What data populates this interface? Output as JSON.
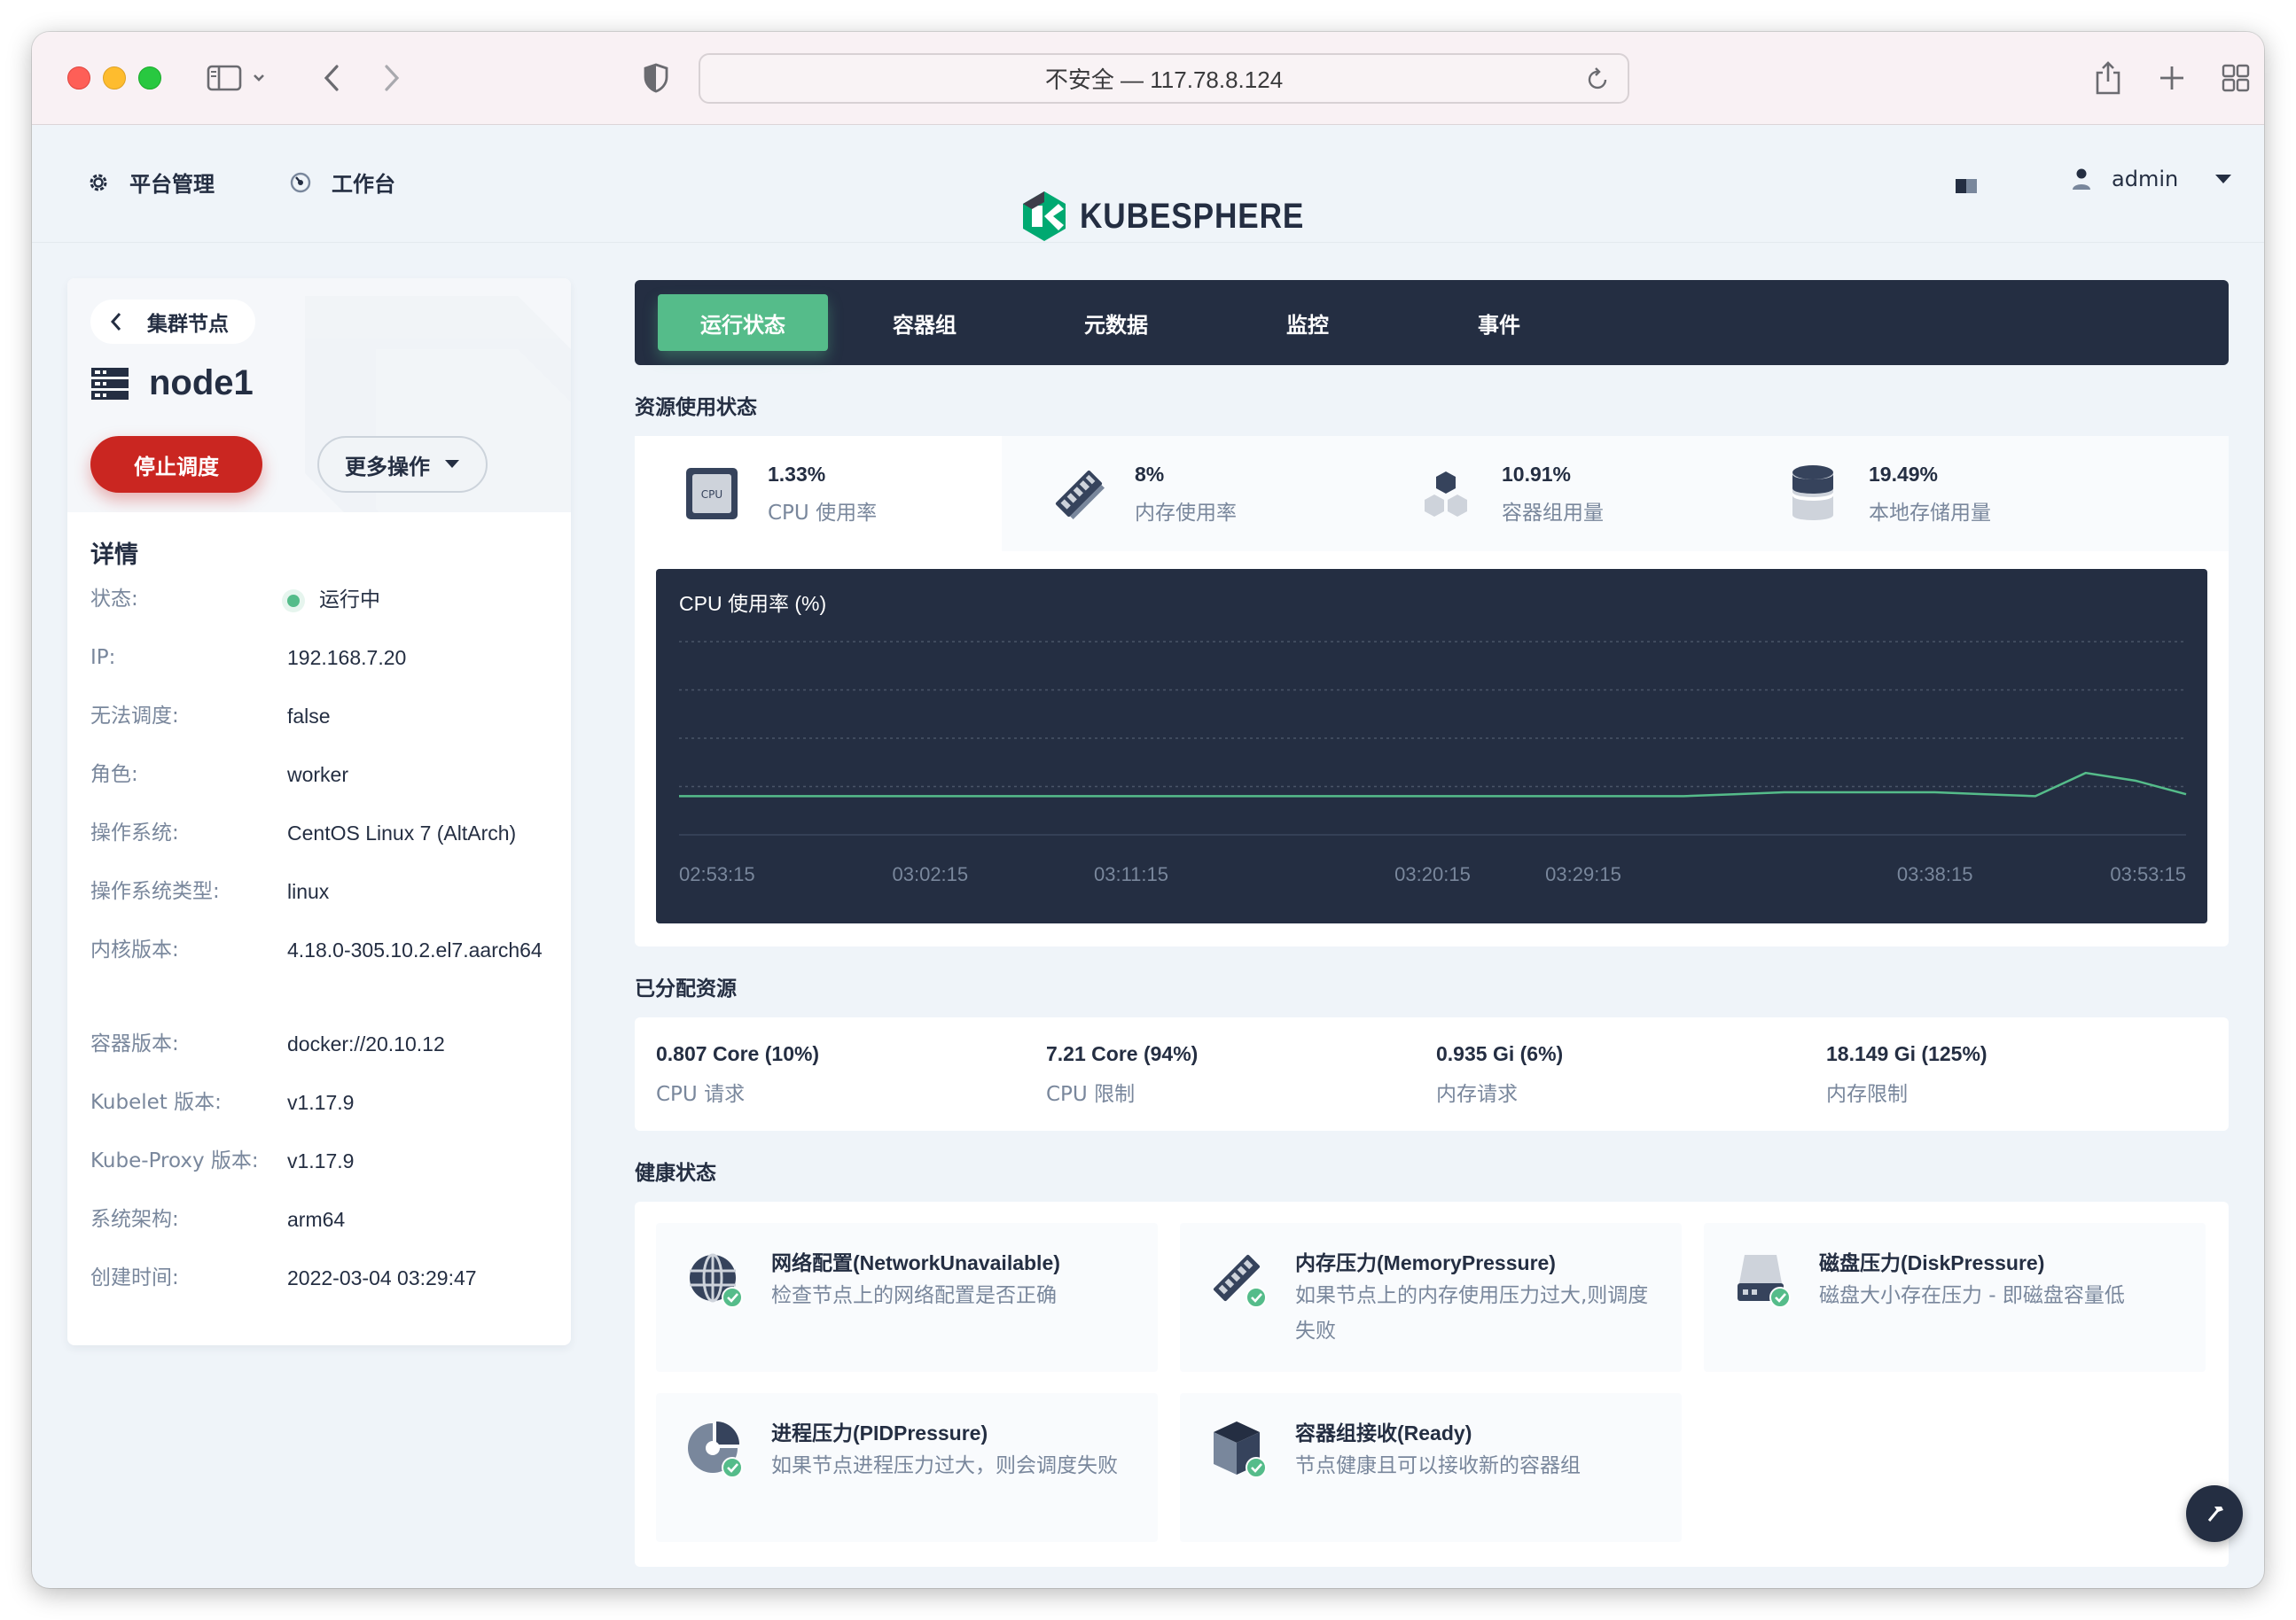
{
  "browser": {
    "address": "不安全 — 117.78.8.124"
  },
  "topnav": {
    "platform_label": "平台管理",
    "workbench_label": "工作台",
    "logo_text": "KUBESPHERE",
    "user_name": "admin"
  },
  "node": {
    "back_label": "集群节点",
    "name": "node1",
    "stop_button": "停止调度",
    "more_button": "更多操作",
    "details_title": "详情",
    "details": [
      {
        "key": "状态:",
        "value": "运行中"
      },
      {
        "key": "IP:",
        "value": "192.168.7.20"
      },
      {
        "key": "无法调度:",
        "value": "false"
      },
      {
        "key": "角色:",
        "value": "worker"
      },
      {
        "key": "操作系统:",
        "value": "CentOS Linux 7 (AltArch)"
      },
      {
        "key": "操作系统类型:",
        "value": "linux"
      },
      {
        "key": "内核版本:",
        "value": "4.18.0-305.10.2.el7.aarch64"
      },
      {
        "key": "容器版本:",
        "value": "docker://20.10.12"
      },
      {
        "key": "Kubelet 版本:",
        "value": "v1.17.9"
      },
      {
        "key": "Kube-Proxy 版本:",
        "value": "v1.17.9"
      },
      {
        "key": "系统架构:",
        "value": "arm64"
      },
      {
        "key": "创建时间:",
        "value": "2022-03-04 03:29:47"
      }
    ]
  },
  "tabs": [
    "运行状态",
    "容器组",
    "元数据",
    "监控",
    "事件"
  ],
  "resource_status": {
    "title": "资源使用状态",
    "items": [
      {
        "value": "1.33%",
        "label": "CPU 使用率",
        "icon": "cpu-icon"
      },
      {
        "value": "8%",
        "label": "内存使用率",
        "icon": "memory-icon"
      },
      {
        "value": "10.91%",
        "label": "容器组用量",
        "icon": "pods-icon"
      },
      {
        "value": "19.49%",
        "label": "本地存储用量",
        "icon": "storage-icon"
      }
    ],
    "cpu_icon_text": "CPU"
  },
  "chart_data": {
    "type": "line",
    "title": "CPU 使用率 (%)",
    "x_tick_labels": [
      "02:53:15",
      "03:02:15",
      "03:11:15",
      "03:20:15",
      "03:29:15",
      "03:38:15",
      "03:53:15"
    ],
    "x": [
      "02:53:15",
      "02:55:15",
      "02:57:15",
      "02:59:15",
      "03:01:15",
      "03:03:15",
      "03:05:15",
      "03:07:15",
      "03:09:15",
      "03:11:15",
      "03:13:15",
      "03:15:15",
      "03:17:15",
      "03:19:15",
      "03:21:15",
      "03:23:15",
      "03:25:15",
      "03:27:15",
      "03:29:15",
      "03:31:15",
      "03:33:15",
      "03:35:15",
      "03:37:15",
      "03:39:15",
      "03:41:15",
      "03:43:15",
      "03:45:15",
      "03:47:15",
      "03:49:15",
      "03:51:15",
      "03:53:15"
    ],
    "series": [
      {
        "values": [
          1.0,
          1.0,
          1.0,
          1.0,
          1.0,
          1.0,
          1.0,
          1.0,
          1.0,
          1.0,
          1.0,
          1.0,
          1.0,
          1.0,
          1.0,
          1.0,
          1.0,
          1.0,
          1.0,
          1.0,
          1.0,
          1.05,
          1.1,
          1.1,
          1.1,
          1.1,
          1.05,
          1.0,
          1.6,
          1.4,
          1.05
        ]
      }
    ],
    "ylim": [
      0,
      5
    ],
    "grid": true,
    "colors": {
      "line": "#55bc8a",
      "background": "#242e42",
      "grid": "#4a5568"
    }
  },
  "allocated": {
    "title": "已分配资源",
    "items": [
      {
        "value": "0.807 Core (10%)",
        "label": "CPU 请求"
      },
      {
        "value": "7.21 Core (94%)",
        "label": "CPU 限制"
      },
      {
        "value": "0.935 Gi (6%)",
        "label": "内存请求"
      },
      {
        "value": "18.149 Gi (125%)",
        "label": "内存限制"
      }
    ]
  },
  "health": {
    "title": "健康状态",
    "items": [
      {
        "name": "网络配置(NetworkUnavailable)",
        "desc": "检查节点上的网络配置是否正确",
        "icon": "network-icon"
      },
      {
        "name": "内存压力(MemoryPressure)",
        "desc": "如果节点上的内存使用压力过大,则调度失败",
        "icon": "memory-icon"
      },
      {
        "name": "磁盘压力(DiskPressure)",
        "desc": "磁盘大小存在压力 - 即磁盘容量低",
        "icon": "disk-icon"
      },
      {
        "name": "进程压力(PIDPressure)",
        "desc": "如果节点进程压力过大，则会调度失败",
        "icon": "pid-icon"
      },
      {
        "name": "容器组接收(Ready)",
        "desc": "节点健康且可以接收新的容器组",
        "icon": "box-icon"
      }
    ]
  },
  "colors": {
    "accent": "#55bc8a",
    "danger": "#ca2621",
    "dark": "#242e42",
    "muted": "#79879c"
  }
}
